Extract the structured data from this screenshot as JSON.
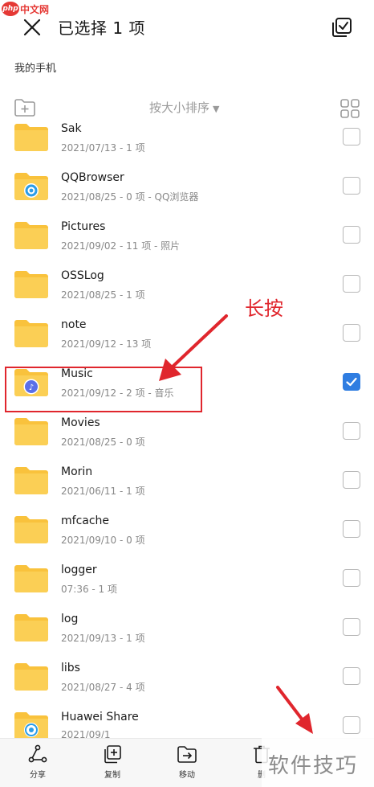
{
  "watermark_php": {
    "logo": "php",
    "text": "中文网"
  },
  "header": {
    "title": "已选择 1 项"
  },
  "breadcrumb": "我的手机",
  "sort": {
    "label": "按大小排序",
    "caret": "▼"
  },
  "files": [
    {
      "name": "Sak",
      "meta": "2021/07/13 - 1 项",
      "checked": false,
      "badge": ""
    },
    {
      "name": "QQBrowser",
      "meta": "2021/08/25 - 0 项 - QQ浏览器",
      "checked": false,
      "badge": "qqbrowser"
    },
    {
      "name": "Pictures",
      "meta": "2021/09/02 - 11 项 - 照片",
      "checked": false,
      "badge": ""
    },
    {
      "name": "OSSLog",
      "meta": "2021/08/25 - 1 项",
      "checked": false,
      "badge": ""
    },
    {
      "name": "note",
      "meta": "2021/09/12 - 13 项",
      "checked": false,
      "badge": ""
    },
    {
      "name": "Music",
      "meta": "2021/09/12 - 2 项 - 音乐",
      "checked": true,
      "badge": "music"
    },
    {
      "name": "Movies",
      "meta": "2021/08/25 - 0 项",
      "checked": false,
      "badge": ""
    },
    {
      "name": "Morin",
      "meta": "2021/06/11 - 1 项",
      "checked": false,
      "badge": ""
    },
    {
      "name": "mfcache",
      "meta": "2021/09/10 - 0 项",
      "checked": false,
      "badge": ""
    },
    {
      "name": "logger",
      "meta": "07:36 - 1 项",
      "checked": false,
      "badge": ""
    },
    {
      "name": "log",
      "meta": "2021/09/13 - 1 项",
      "checked": false,
      "badge": ""
    },
    {
      "name": "libs",
      "meta": "2021/08/27 - 4 项",
      "checked": false,
      "badge": ""
    },
    {
      "name": "Huawei Share",
      "meta": "2021/09/1",
      "checked": false,
      "badge": "huaweishare"
    }
  ],
  "annotation": {
    "label": "长按"
  },
  "bottom_bar": {
    "share": "分享",
    "copy": "复制",
    "move": "移动",
    "delete": "删"
  },
  "watermark_brand": "软件技巧",
  "colors": {
    "accent": "#2f7de1",
    "folder": "#f9c23c",
    "annotation": "#e0262d"
  }
}
